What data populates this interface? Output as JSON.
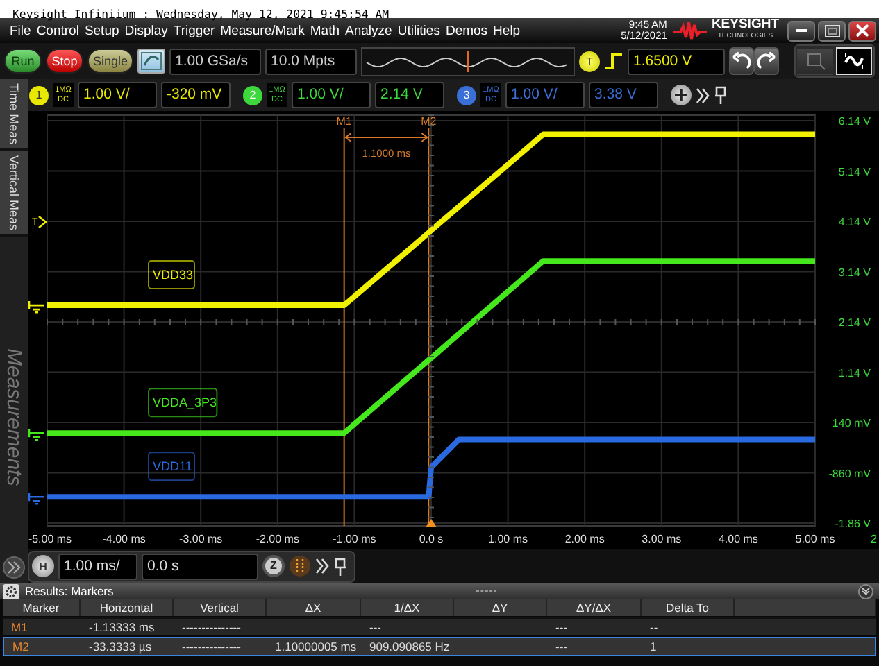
{
  "title_bar": {
    "text": "Keysight Infiniium : Wednesday, May 12, 2021 9:45:54 AM"
  },
  "menu": [
    "File",
    "Control",
    "Setup",
    "Display",
    "Trigger",
    "Measure/Mark",
    "Math",
    "Analyze",
    "Utilities",
    "Demos",
    "Help"
  ],
  "clock": {
    "time": "9:45 AM",
    "date": "5/12/2021"
  },
  "logo": {
    "name": "KEYSIGHT",
    "tagline": "TECHNOLOGIES"
  },
  "window_buttons": [
    {
      "kind": "minimize"
    },
    {
      "kind": "restore"
    },
    {
      "kind": "close"
    }
  ],
  "acquisition_buttons": [
    {
      "label": "Run",
      "kind": "run"
    },
    {
      "label": "Stop",
      "kind": "stop"
    },
    {
      "label": "Single",
      "kind": "single"
    }
  ],
  "sample_rate": "1.00 GSa/s",
  "memory_depth": "10.0 Mpts",
  "trigger": {
    "badge": "T",
    "level": "1.6500 V"
  },
  "history_buttons": [
    {
      "kind": "undo"
    },
    {
      "kind": "redo"
    }
  ],
  "tool_buttons": [
    {
      "kind": "marker",
      "selected": false
    },
    {
      "kind": "waveform",
      "selected": true
    }
  ],
  "channels": [
    {
      "number": "1",
      "impedance": "1MΩ",
      "coupling": "DC",
      "scale": "1.00 V/",
      "offset": "-320 mV",
      "color": "#e8e800"
    },
    {
      "number": "2",
      "impedance": "1MΩ",
      "coupling": "DC",
      "scale": "1.00 V/",
      "offset": "2.14 V",
      "color": "#3cd83c"
    },
    {
      "number": "3",
      "impedance": "1MΩ",
      "coupling": "DC",
      "scale": "1.00 V/",
      "offset": "3.38 V",
      "color": "#3a6fd8"
    }
  ],
  "side_tabs": [
    {
      "label": "Time Meas",
      "selected": false
    },
    {
      "label": "Vertical Meas",
      "selected": false
    }
  ],
  "side_panel_label": "Measurements",
  "display": {
    "edge_label": "2",
    "chart_data": {
      "type": "line",
      "x": [
        -5,
        -1.1333,
        -0.0333,
        0,
        0.36,
        1.46,
        5
      ],
      "series": [
        {
          "name": "VDD33",
          "color": "#f0f000",
          "values": [
            2.47,
            2.47,
            3.91,
            3.96,
            4.43,
            5.87,
            5.87
          ]
        },
        {
          "name": "VDDA_3P3",
          "color": "#44e81c",
          "values": [
            -0.07,
            -0.07,
            1.38,
            1.42,
            1.9,
            3.35,
            3.35
          ]
        },
        {
          "name": "VDD11",
          "color": "#2a6ae0",
          "values": [
            -1.34,
            -1.34,
            -1.34,
            -0.75,
            -0.2,
            -0.2,
            -0.2
          ]
        }
      ],
      "xlim": [
        -5,
        5
      ],
      "ylim": [
        -1.86,
        6.14
      ],
      "xticks": [
        {
          "value": -5,
          "label": "-5.00 ms"
        },
        {
          "value": -4,
          "label": "-4.00 ms"
        },
        {
          "value": -3,
          "label": "-3.00 ms"
        },
        {
          "value": -2,
          "label": "-2.00 ms"
        },
        {
          "value": -1,
          "label": "-1.00 ms"
        },
        {
          "value": 0,
          "label": "0.0 s"
        },
        {
          "value": 1,
          "label": "1.00 ms"
        },
        {
          "value": 2,
          "label": "2.00 ms"
        },
        {
          "value": 3,
          "label": "3.00 ms"
        },
        {
          "value": 4,
          "label": "4.00 ms"
        },
        {
          "value": 5,
          "label": "5.00 ms"
        }
      ],
      "yticks": [
        {
          "value": 6.14,
          "label": "6.14 V"
        },
        {
          "value": 5.14,
          "label": "5.14 V"
        },
        {
          "value": 4.14,
          "label": "4.14 V"
        },
        {
          "value": 3.14,
          "label": "3.14 V"
        },
        {
          "value": 2.14,
          "label": "2.14 V"
        },
        {
          "value": 1.14,
          "label": "1.14 V"
        },
        {
          "value": -1.86,
          "label": "-1.86 V"
        }
      ],
      "grid": true,
      "ref_lines": [
        {
          "axis": "x",
          "value": -1.1333,
          "label": "M1",
          "color": "#d77a28"
        },
        {
          "axis": "x",
          "value": -0.0333,
          "label": "M2",
          "color": "#d77a28"
        }
      ]
    },
    "millivolt_axis_labels": [
      "140 mV",
      "-860 mV"
    ],
    "marker_delta": "1.1000 ms",
    "trigger_marker": {
      "label": "T"
    }
  },
  "horizontal": {
    "badge": "H",
    "scale": "1.00 ms/",
    "delay": "0.0 s",
    "zoom_badge": "Z"
  },
  "results": {
    "title": "Results: Markers",
    "columns": [
      "Marker",
      "Horizontal",
      "Vertical",
      "ΔX",
      "1/ΔX",
      "ΔY",
      "ΔY/ΔX",
      "Delta To"
    ],
    "rows": [
      {
        "selected": false,
        "cells": [
          "M1",
          "-1.13333 ms",
          "---------------",
          null,
          "---",
          null,
          "---",
          "--"
        ]
      },
      {
        "selected": true,
        "cells": [
          "M2",
          "-33.3333 µs",
          "---------------",
          "1.10000005 ms",
          "909.090865 Hz",
          null,
          "---",
          "1"
        ]
      }
    ]
  }
}
